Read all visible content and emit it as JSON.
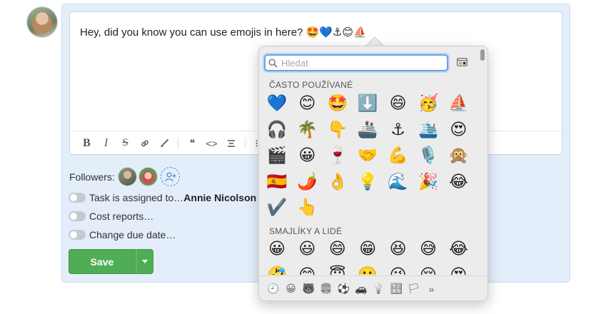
{
  "comment": {
    "text": "Hey, did you know you can use emojis in here? 🤩💙⚓😊⛵"
  },
  "toolbar": {
    "bold": "B",
    "italic": "I",
    "strike": "S",
    "quote": "❝",
    "code": "<>"
  },
  "followers": {
    "label": "Followers:"
  },
  "toggles": [
    {
      "label": "Task is assigned to… ",
      "strong": "Annie Nicolson"
    },
    {
      "label": "Cost reports…",
      "strong": ""
    },
    {
      "label": "Change due date…",
      "strong": ""
    }
  ],
  "save": {
    "label": "Save"
  },
  "picker": {
    "search_placeholder": "Hledat",
    "frequent_title": "ČASTO POUŽÍVANÉ",
    "smileys_title": "SMAJLÍKY A LIDÉ",
    "frequent": [
      [
        "💙",
        "😊",
        "🤩",
        "⬇️",
        "😄",
        "🥳",
        "⛵"
      ],
      [
        "🎧",
        "🌴",
        "👇",
        "🚢",
        "⚓",
        "🛳️",
        "😍"
      ],
      [
        "🎬",
        "😀",
        "🍷",
        "🤝",
        "💪",
        "🎙️",
        "🙊"
      ],
      [
        "🇪🇸",
        "🌶️",
        "👌",
        "💡",
        "🌊",
        "🎉",
        "😂"
      ],
      [
        "✔️",
        "👆"
      ]
    ],
    "smileys": [
      [
        "😀",
        "😃",
        "😄",
        "😁",
        "😆",
        "😅",
        "😂"
      ],
      [
        "🤣",
        "😊",
        "😇",
        "🙂",
        "😉",
        "😌",
        "😍"
      ]
    ],
    "categories": [
      "🕘",
      "😀",
      "🐻",
      "🍔",
      "⚽",
      "🚗",
      "💡",
      "🔣",
      "🏳",
      "»"
    ]
  },
  "colors": {
    "accent": "#2f7be0",
    "save_green": "#4fae55",
    "panel_bg": "#e4eefa"
  }
}
